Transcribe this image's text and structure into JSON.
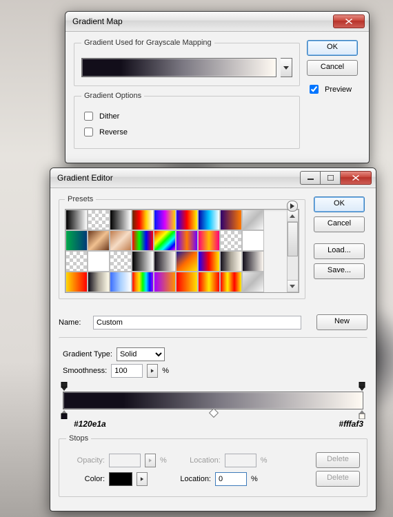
{
  "gradientMap": {
    "title": "Gradient Map",
    "fieldset1": "Gradient Used for Grayscale Mapping",
    "fieldset2": "Gradient Options",
    "dither": "Dither",
    "reverse": "Reverse",
    "ok": "OK",
    "cancel": "Cancel",
    "preview": "Preview",
    "gradient": {
      "start": "#120e1a",
      "end": "#fffaf3"
    }
  },
  "gradientEditor": {
    "title": "Gradient Editor",
    "presets_label": "Presets",
    "ok": "OK",
    "cancel": "Cancel",
    "load": "Load...",
    "save": "Save...",
    "name_label": "Name:",
    "name_value": "Custom",
    "new": "New",
    "gradient_type_label": "Gradient Type:",
    "gradient_type_value": "Solid",
    "smoothness_label": "Smoothness:",
    "smoothness_value": "100",
    "percent": "%",
    "left_hex": "#120e1a",
    "right_hex": "#fffaf3",
    "stops_label": "Stops",
    "opacity_label": "Opacity:",
    "location_label": "Location:",
    "delete": "Delete",
    "color_label": "Color:",
    "color_location_value": "0"
  },
  "presets": [
    [
      "linear-gradient(90deg,#000,#fff)",
      "checker",
      "linear-gradient(90deg,#000,#fff)",
      "linear-gradient(90deg,#652a00,#ff0000,#ffd200,#ffffff)",
      "linear-gradient(90deg,#001aff,#d600ff,#ffd200)",
      "linear-gradient(90deg,#1b00ff,#ff0000,#fff600)",
      "linear-gradient(90deg,#0600a8,#00c3ff,#fff)",
      "linear-gradient(90deg,#2e006e,#ff7a00)",
      "linear-gradient(135deg,#e8e8e8,#bcbcbc,#f7f7f7)"
    ],
    [
      "linear-gradient(90deg,#00a84a,#003a78)",
      "linear-gradient(135deg,#6d3a1e,#f0c090,#6d3a1e)",
      "linear-gradient(135deg,#c07d4e,#f6dcc5,#c07d4e)",
      "linear-gradient(90deg,#ff0000,#00ff00,#0000ff,#ff0000)",
      "linear-gradient(135deg,#ff0000,#ff9900,#ffff00,#00ff00,#00ffff,#0000ff,#ff00ff)",
      "linear-gradient(90deg,#7000ff,#ff7a00,#7000ff)",
      "linear-gradient(90deg,#ff007b,#ffbb00,#ff007b)",
      "checker",
      "#ffffff"
    ],
    [
      "checker",
      "#ffffff",
      "checker",
      "linear-gradient(90deg,#000,#fff)",
      "linear-gradient(90deg,#120e1a,#fffaf3)",
      "linear-gradient(135deg,#1717a0,#ff6a00,#ffe400)",
      "linear-gradient(90deg,#1400ff,#ff0000,#ffec00)",
      "linear-gradient(90deg,#120e1a,#ada79a,#fffaee)",
      "linear-gradient(90deg,#120e1a,#fffaf3)"
    ],
    [
      "linear-gradient(90deg,#ffd800,#ff0000)",
      "linear-gradient(90deg,#120e1a,#ada79a,#fffcea)",
      "linear-gradient(90deg,#3b6fff,#a9d0ff,#fff)",
      "linear-gradient(90deg,#ff0000,#ff8a00,#ffe600,#00ff00,#00e0ff,#001bff,#9b00ff)",
      "linear-gradient(90deg,#a100ff,#ff9100)",
      "linear-gradient(90deg,#ff0000,#ffe300)",
      "linear-gradient(90deg,#ff0000,#ffea00,#ff0000)",
      "linear-gradient(90deg,#ff0000,#fff000,#ff0000,#fff000)",
      "linear-gradient(135deg,#e8e8e8,#bcbcbc,#f7f7f7)"
    ]
  ]
}
